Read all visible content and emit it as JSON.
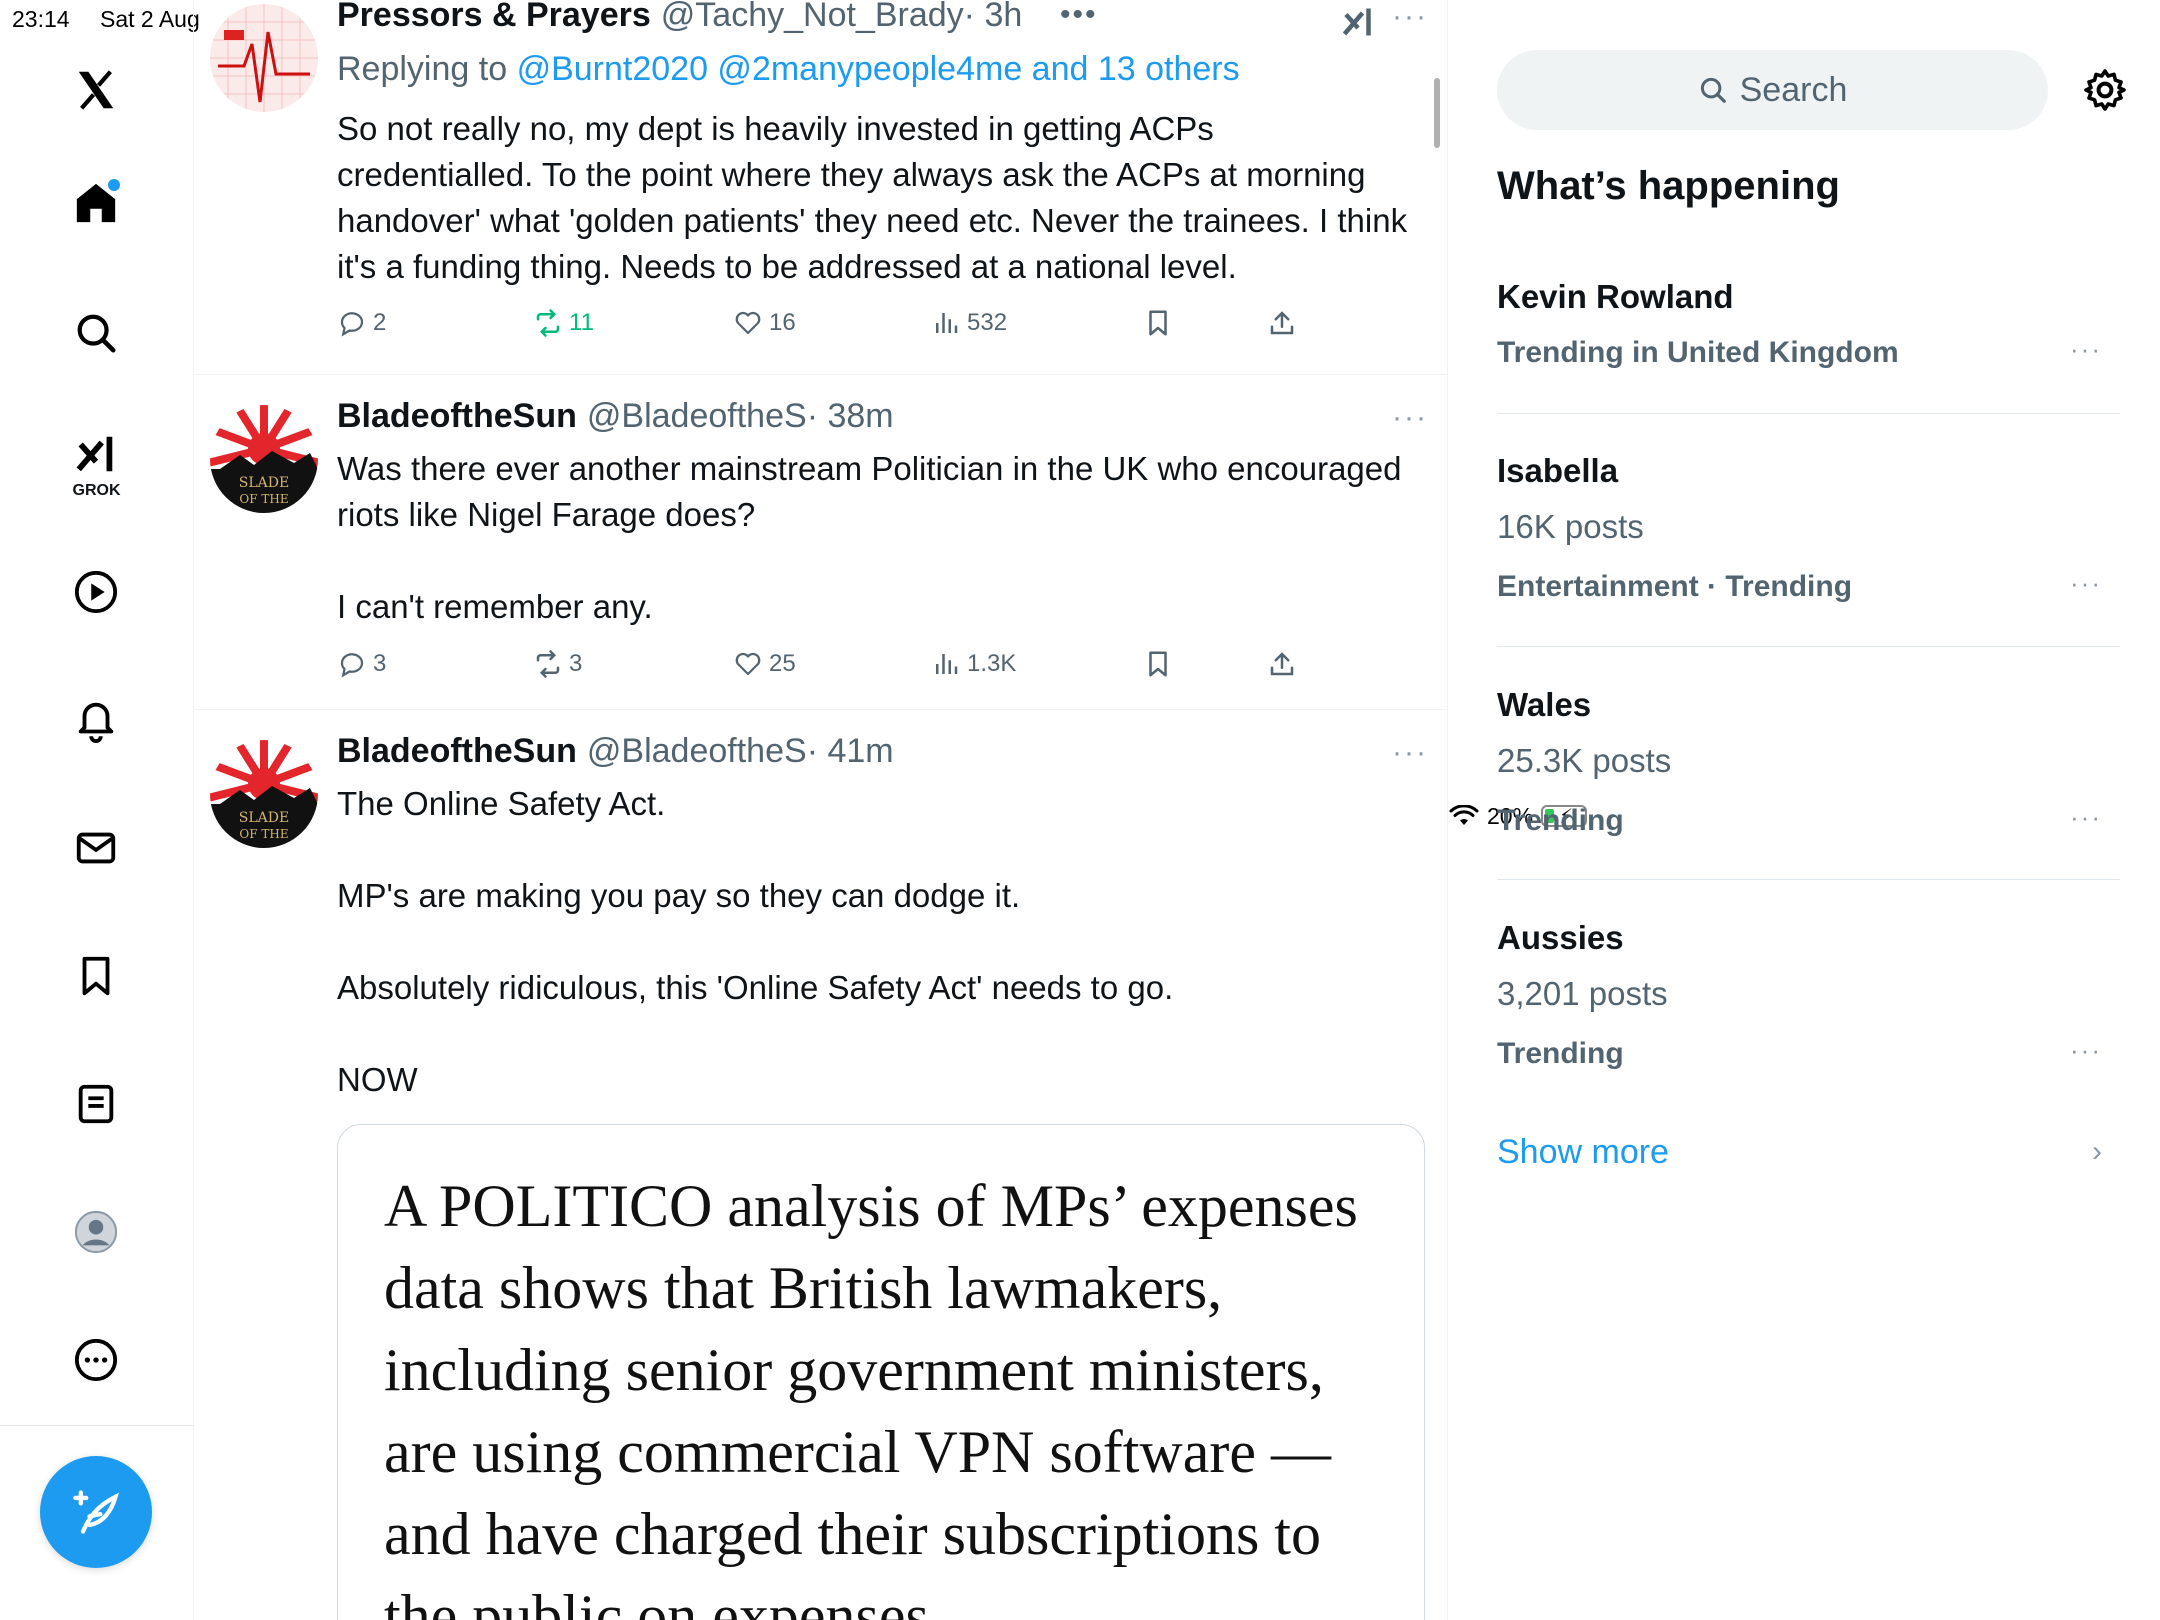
{
  "status_bar": {
    "time": "23:14",
    "date": "Sat 2 Aug",
    "battery": "20%"
  },
  "sidebar": {
    "grok_label": "GROK",
    "items": [
      "home",
      "explore",
      "grok",
      "video",
      "notifications",
      "messages",
      "bookmarks",
      "lists",
      "profile",
      "more"
    ],
    "accent_color": "#1d9bf0"
  },
  "feed": {
    "tweets": [
      {
        "name": "Pressors & Prayers",
        "handle": "@Tachy_Not_Brady",
        "time": "· 3h",
        "replying_prefix": "Replying to",
        "replying_to": "@Burnt2020 @2manypeople4me and 13 others",
        "text": "So not really no, my dept is heavily invested in getting ACPs credentialled. To the point where they always ask the ACPs at morning handover' what 'golden patients' they need etc. Never the trainees. I think it's a funding thing. Needs to be addressed at a national level.",
        "replies": "2",
        "reposts": "11",
        "likes": "16",
        "views": "532"
      },
      {
        "name": "BladeoftheSun",
        "handle": "@BladeoftheS",
        "time": "· 38m",
        "text": "Was there ever another mainstream Politician in the UK who encouraged riots like Nigel Farage does?\n\nI can't remember any.",
        "replies": "3",
        "reposts": "3",
        "likes": "25",
        "views": "1.3K"
      },
      {
        "name": "BladeoftheSun",
        "handle": "@BladeoftheS",
        "time": "· 41m",
        "text": "The Online Safety Act.\n\nMP's are making you pay so they can dodge it.\n\nAbsolutely ridiculous, this 'Online Safety Act' needs to go.\n\nNOW",
        "card_text": "A POLITICO analysis of MPs’ expenses data shows that British lawmakers, including senior government ministers, are using commercial VPN software — and have charged their subscriptions to the public on expenses."
      }
    ]
  },
  "right": {
    "search_placeholder": "Search",
    "title": "What’s happening",
    "trends": [
      {
        "name": "Kevin Rowland",
        "posts": "",
        "category": "Trending in United Kingdom"
      },
      {
        "name": "Isabella",
        "posts": "16K posts",
        "category": "Entertainment · Trending"
      },
      {
        "name": "Wales",
        "posts": "25.3K posts",
        "category": "Trending"
      },
      {
        "name": "Aussies",
        "posts": "3,201 posts",
        "category": "Trending"
      }
    ],
    "show_more": "Show more"
  }
}
